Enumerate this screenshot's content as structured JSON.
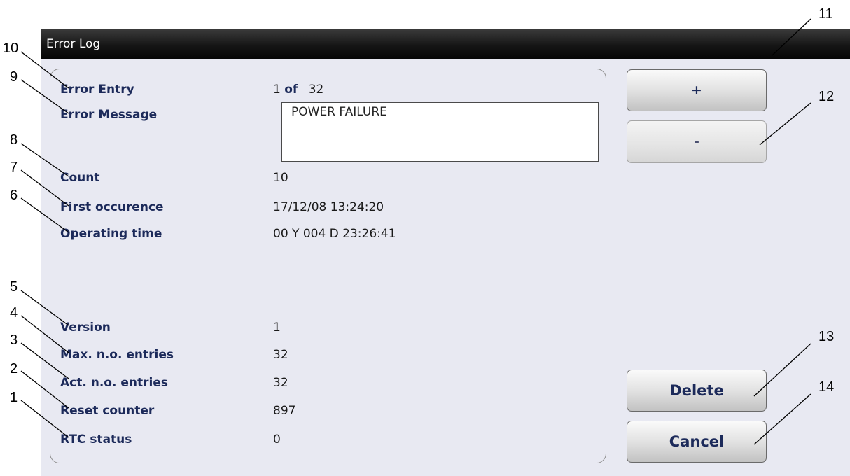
{
  "window": {
    "title": "Error Log"
  },
  "fields": {
    "error_entry": {
      "label": "Error Entry",
      "current": "1",
      "of": "of",
      "total": "32"
    },
    "error_message": {
      "label": "Error Message",
      "value": "POWER FAILURE"
    },
    "count": {
      "label": "Count",
      "value": "10"
    },
    "first_occurence": {
      "label": "First occurence",
      "value": "17/12/08 13:24:20"
    },
    "operating_time": {
      "label": "Operating time",
      "value": "00 Y 004 D 23:26:41"
    },
    "version": {
      "label": "Version",
      "value": "1"
    },
    "max_entries": {
      "label": "Max. n.o. entries",
      "value": "32"
    },
    "act_entries": {
      "label": "Act. n.o. entries",
      "value": "32"
    },
    "reset_counter": {
      "label": "Reset counter",
      "value": "897"
    },
    "rtc_status": {
      "label": "RTC status",
      "value": "0"
    }
  },
  "buttons": {
    "plus": "+",
    "minus": "-",
    "delete": "Delete",
    "cancel": "Cancel"
  },
  "callouts": [
    "1",
    "2",
    "3",
    "4",
    "5",
    "6",
    "7",
    "8",
    "9",
    "10",
    "11",
    "12",
    "13",
    "14"
  ]
}
